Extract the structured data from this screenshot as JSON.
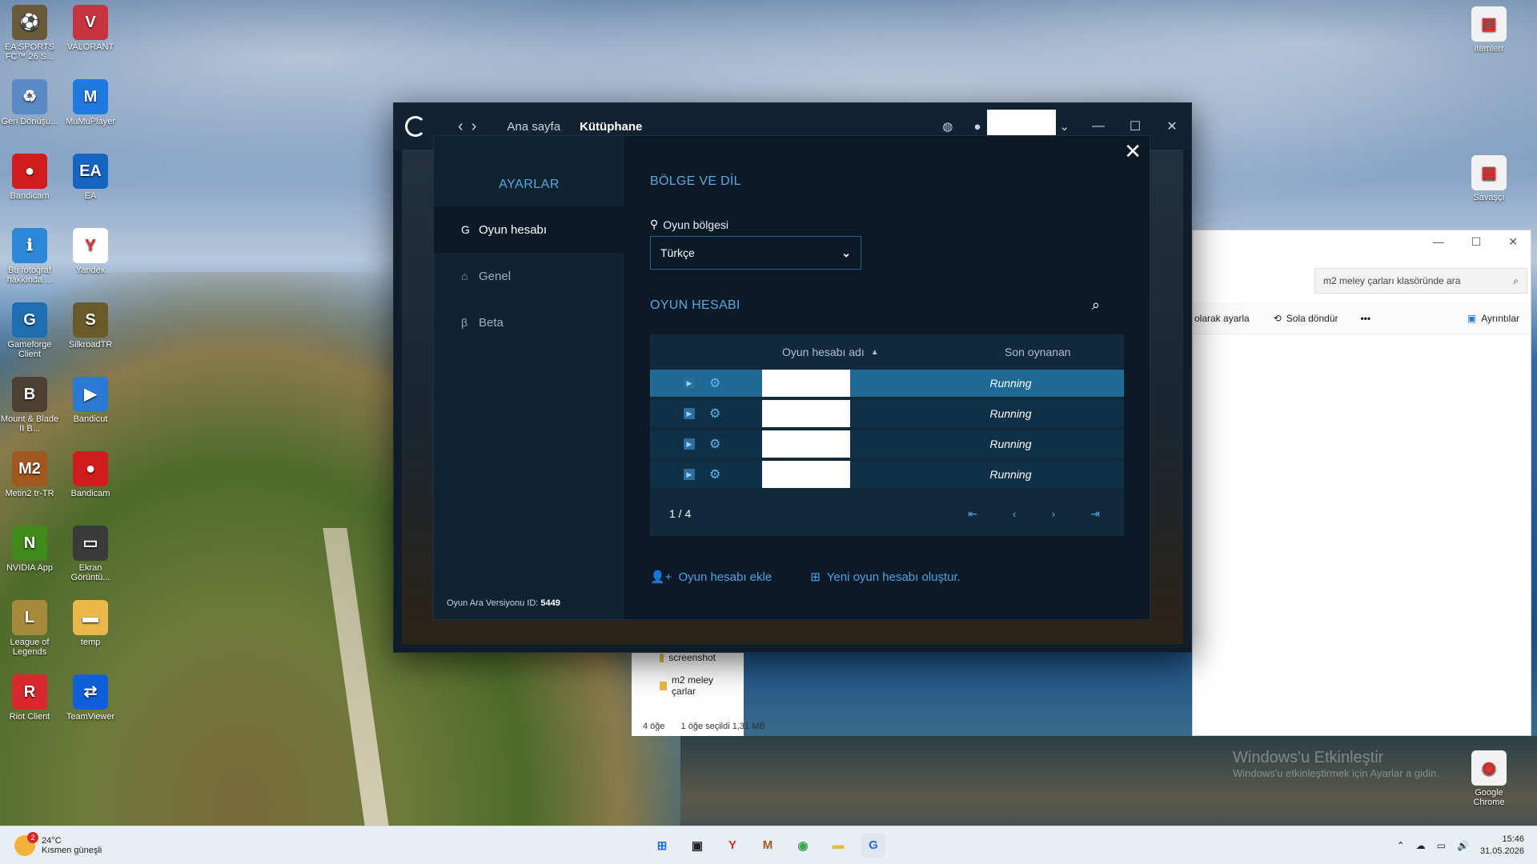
{
  "desktop": {
    "left_icons": [
      {
        "label": "EA SPORTS FC™ 26 S...",
        "color": "#6b5a3a",
        "glyph": "⚽"
      },
      {
        "label": "VALORANT",
        "color": "#c7343f",
        "glyph": "V"
      },
      {
        "label": "Geri Dönüşü...",
        "color": "#5a8ac4",
        "glyph": "♻"
      },
      {
        "label": "MuMuPlayer",
        "color": "#1f7ae0",
        "glyph": "M"
      },
      {
        "label": "Bandicam",
        "color": "#d01c1c",
        "glyph": "●"
      },
      {
        "label": "EA",
        "color": "#1565c0",
        "glyph": "EA"
      },
      {
        "label": "Bu fotoğraf hakkında ...",
        "color": "#2b88d8",
        "glyph": "ℹ"
      },
      {
        "label": "Yandex",
        "color": "#ffffff",
        "glyph": "Y"
      },
      {
        "label": "Gameforge Client",
        "color": "#1f6fb0",
        "glyph": "G"
      },
      {
        "label": "SilkroadTR",
        "color": "#6a5a2a",
        "glyph": "S"
      },
      {
        "label": "Mount & Blade II B...",
        "color": "#4b4032",
        "glyph": "B"
      },
      {
        "label": "Bandicut",
        "color": "#2a7ad4",
        "glyph": "▶"
      },
      {
        "label": "Metin2 tr-TR",
        "color": "#a2581d",
        "glyph": "M2"
      },
      {
        "label": "Bandicam",
        "color": "#d01c1c",
        "glyph": "●"
      },
      {
        "label": "NVIDIA App",
        "color": "#3f8a1a",
        "glyph": "N"
      },
      {
        "label": "Ekran Görüntü...",
        "color": "#3a3a3a",
        "glyph": "▭"
      },
      {
        "label": "League of Legends",
        "color": "#a58a3c",
        "glyph": "L"
      },
      {
        "label": "temp",
        "color": "#e8b84a",
        "glyph": "▬"
      },
      {
        "label": "Riot Client",
        "color": "#d8282d",
        "glyph": "R"
      },
      {
        "label": "TeamViewer",
        "color": "#0e5fd8",
        "glyph": "⇄"
      }
    ],
    "right_icons": [
      {
        "label": "İtemlerr",
        "color": "#f2f2f2",
        "glyph": "▤"
      },
      {
        "label": "Savaşçı",
        "color": "#f2f2f2",
        "glyph": "▤"
      },
      {
        "label": "Google Chrome",
        "color": "#f2f2f2",
        "glyph": "◉"
      }
    ]
  },
  "gameforge": {
    "nav": {
      "home": "Ana sayfa",
      "library": "Kütüphane"
    },
    "settings": {
      "title": "AYARLAR",
      "menu": [
        {
          "label": "Oyun hesabı",
          "icon": "gameforge-icon",
          "glyph": "G"
        },
        {
          "label": "Genel",
          "icon": "home-icon",
          "glyph": "⌂"
        },
        {
          "label": "Beta",
          "icon": "beta-icon",
          "glyph": "β"
        }
      ],
      "version_label": "Oyun Ara Versiyonu ID:",
      "version_id": "5449",
      "region_section": "BÖLGE VE DİL",
      "region_label": "Oyun bölgesi",
      "region_value": "Türkçe",
      "accounts_section": "OYUN HESABI",
      "table": {
        "col_name": "Oyun hesabı adı",
        "col_last": "Son oynanan",
        "rows": [
          {
            "status": "Running"
          },
          {
            "status": "Running"
          },
          {
            "status": "Running"
          },
          {
            "status": "Running"
          }
        ],
        "page": "1 / 4"
      },
      "add_account": "Oyun hesabı ekle",
      "create_account": "Yeni oyun hesabı oluştur."
    }
  },
  "explorer": {
    "search_placeholder": "m2 meley çarları klasöründe ara",
    "toolbar": {
      "set_as": "olarak ayarla",
      "rotate_left": "Sola döndür",
      "more": "•••",
      "details": "Ayrıntılar"
    },
    "folders": [
      "screenshot",
      "m2 meley çarlar"
    ],
    "status_count": "4 öğe",
    "status_selected": "1 öğe seçildi  1,31 MB"
  },
  "watermark": {
    "line1": "Windows'u Etkinleştir",
    "line2": "Windows'u etkinleştirmek için Ayarlar a gidin."
  },
  "taskbar": {
    "temp": "24°C",
    "weather": "Kısmen güneşli",
    "badge": "2",
    "time": "15:46",
    "date": "31.05.2026"
  }
}
